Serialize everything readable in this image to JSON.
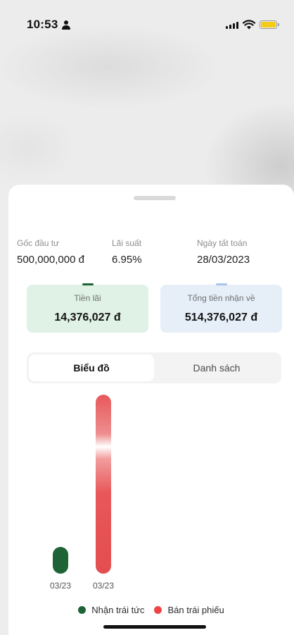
{
  "status_bar": {
    "time": "10:53"
  },
  "investment": {
    "principal_label": "Gốc đầu tư",
    "principal_value": "500,000,000 đ",
    "rate_label": "Lãi suất",
    "rate_value": "6.95%",
    "maturity_label": "Ngày tất toán",
    "maturity_value": "28/03/2023"
  },
  "cards": {
    "interest": {
      "label": "Tiền lãi",
      "value": "14,376,027 đ",
      "accent": "#1e6335",
      "bg": "#dff2e5"
    },
    "total": {
      "label": "Tổng tiền nhận về",
      "value": "514,376,027 đ",
      "accent": "#a8c4e8",
      "bg": "#e6eff8"
    }
  },
  "tabs": [
    {
      "label": "Biểu đồ",
      "active": true
    },
    {
      "label": "Danh sách",
      "active": false
    }
  ],
  "chart_data": {
    "type": "bar",
    "categories": [
      "03/23",
      "03/23"
    ],
    "series": [
      {
        "name": "Nhận trái tức",
        "color": "#1e6335",
        "values": [
          14376027,
          null
        ]
      },
      {
        "name": "Bán trái phiếu",
        "color": "#e8585a",
        "values": [
          null,
          500000000
        ]
      }
    ],
    "legend_position": "bottom-center",
    "grid": false
  },
  "legend": [
    {
      "label": "Nhận trái tức",
      "color": "#1e6335"
    },
    {
      "label": "Bán trái phiếu",
      "color": "#ee4444"
    }
  ],
  "icons": {
    "person": "person-icon",
    "signal": "signal-icon",
    "wifi": "wifi-icon",
    "battery": "battery-icon"
  }
}
